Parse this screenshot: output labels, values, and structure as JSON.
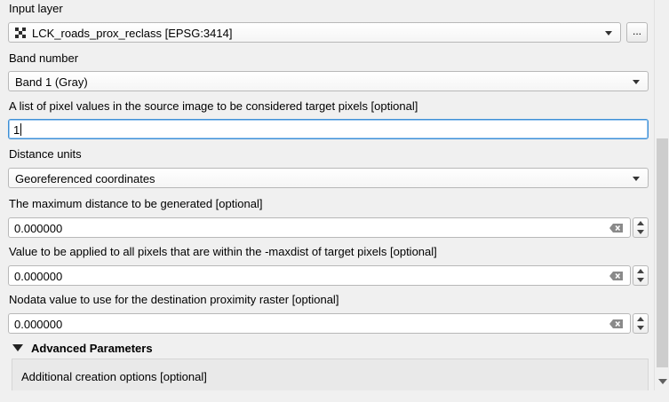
{
  "fields": {
    "input_layer": {
      "label": "Input layer",
      "value": "LCK_roads_prox_reclass [EPSG:3414]",
      "browse_label": "..."
    },
    "band_number": {
      "label": "Band number",
      "value": "Band 1 (Gray)"
    },
    "target_pixels": {
      "label": "A list of pixel values in the source image to be considered target pixels [optional]",
      "value": "1"
    },
    "distance_units": {
      "label": "Distance units",
      "value": "Georeferenced coordinates"
    },
    "max_distance": {
      "label": "The maximum distance to be generated [optional]",
      "value": "0.000000"
    },
    "replace_value": {
      "label": "Value to be applied to all pixels that are within the -maxdist of target pixels [optional]",
      "value": "0.000000"
    },
    "nodata_value": {
      "label": "Nodata value to use for the destination proximity raster [optional]",
      "value": "0.000000"
    }
  },
  "advanced": {
    "title": "Advanced Parameters",
    "creation_options_label": "Additional creation options [optional]"
  },
  "icons": {
    "layer": "raster-layer-icon",
    "clear": "clear-backspace-icon",
    "dropdown": "chevron-down-icon",
    "collapse": "triangle-down-icon"
  },
  "colors": {
    "focus_border": "#3d8fd6",
    "background": "#f0f0f0"
  }
}
